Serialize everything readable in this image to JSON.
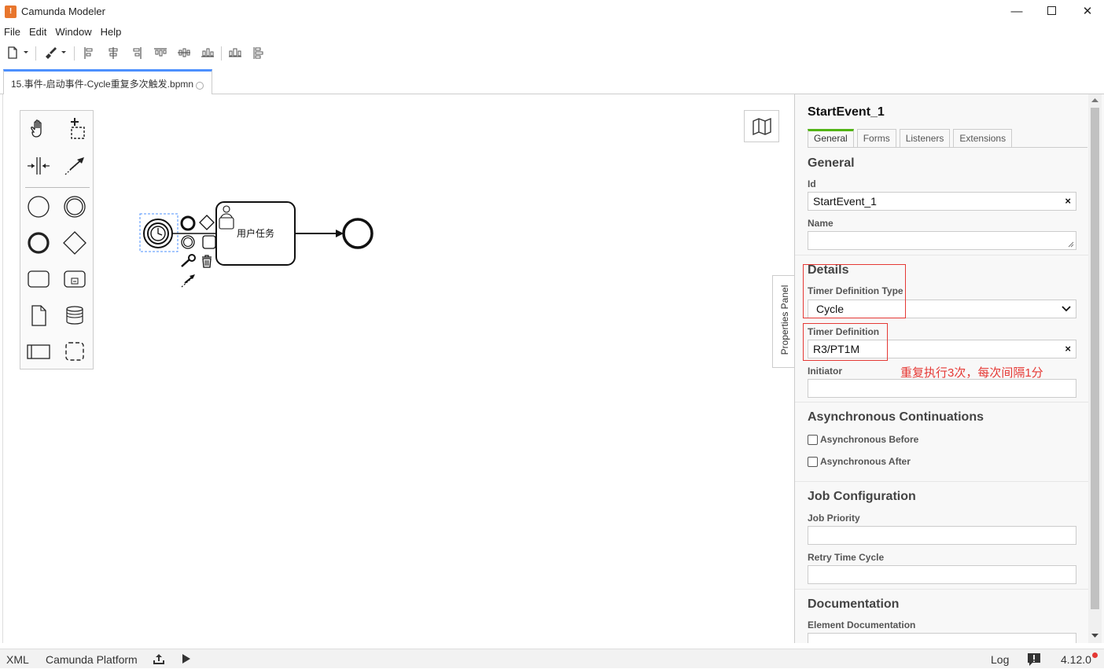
{
  "window": {
    "title": "Camunda Modeler",
    "logo_glyph": "!"
  },
  "menu": [
    "File",
    "Edit",
    "Window",
    "Help"
  ],
  "toolbar": {
    "icons": [
      "new-file-icon",
      "dropdown-icon",
      "paintbrush-icon",
      "dropdown-icon",
      "align-left-icon",
      "align-center-icon",
      "align-right-icon",
      "align-top-icon",
      "align-middle-icon",
      "align-bottom-icon",
      "distribute-horizontal-icon",
      "distribute-vertical-icon"
    ]
  },
  "tab": {
    "filename": "15.事件-启动事件-Cycle重复多次触发.bpmn"
  },
  "diagram": {
    "task_label": "用户任务"
  },
  "properties": {
    "toggle_label": "Properties Panel",
    "title": "StartEvent_1",
    "tabs": [
      "General",
      "Forms",
      "Listeners",
      "Extensions"
    ],
    "general": {
      "heading": "General",
      "id_label": "Id",
      "id_value": "StartEvent_1",
      "name_label": "Name",
      "name_value": ""
    },
    "details": {
      "heading": "Details",
      "timer_type_label": "Timer Definition Type",
      "timer_type_value": "Cycle",
      "timer_def_label": "Timer Definition",
      "timer_def_value": "R3/PT1M",
      "initiator_label": "Initiator",
      "annotation": "重复执行3次，每次间隔1分"
    },
    "async": {
      "heading": "Asynchronous Continuations",
      "before_label": "Asynchronous Before",
      "after_label": "Asynchronous After"
    },
    "job": {
      "heading": "Job Configuration",
      "priority_label": "Job Priority",
      "retry_label": "Retry Time Cycle"
    },
    "documentation": {
      "heading": "Documentation",
      "element_doc_label": "Element Documentation"
    },
    "clear_glyph": "×"
  },
  "status": {
    "xml": "XML",
    "platform": "Camunda Platform",
    "log": "Log",
    "version": "4.12.0"
  },
  "colors": {
    "accent_tab": "#4d90fe",
    "props_tab_active": "#52b415",
    "annotation_red": "#e53935"
  }
}
